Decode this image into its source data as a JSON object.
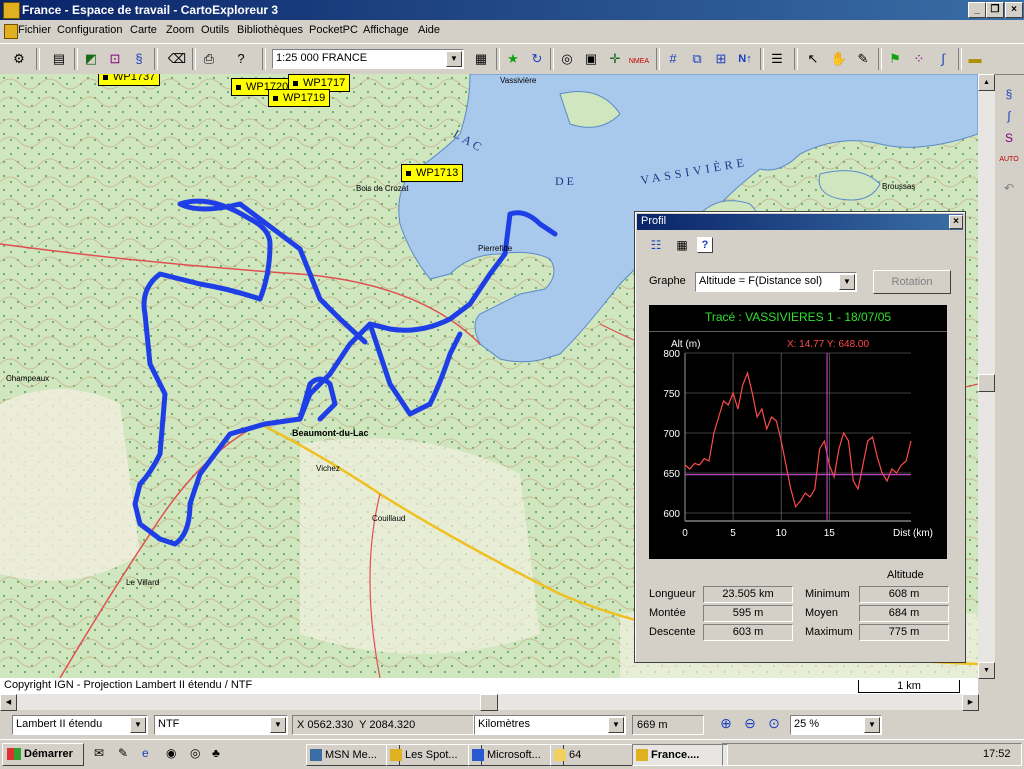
{
  "window": {
    "title": "France - Espace de travail - CartoExploreur 3"
  },
  "menu": [
    "Fichier",
    "Configuration",
    "Carte",
    "Zoom",
    "Outils",
    "Bibliothèques",
    "PocketPC",
    "Affichage",
    "Aide"
  ],
  "toolbar": {
    "scale": "1:25 000 FRANCE",
    "nmea": "NMEA",
    "north": "N↑"
  },
  "map": {
    "lake_words": [
      "LAC",
      "DE",
      "VASSIVIÈRE"
    ],
    "places": [
      "Vassivière",
      "Bois de Crozat",
      "Pierrefitte",
      "Beaumont-du-Lac",
      "Vichez",
      "Broussas",
      "Le Villard",
      "Couillaud",
      "Champeaux"
    ],
    "waypoints": [
      "WP1737",
      "WP1720",
      "WP1717",
      "WP1719",
      "WP1713"
    ]
  },
  "copyright": "Copyright IGN - Projection Lambert II étendu / NTF",
  "scalebar": "1 km",
  "status": {
    "projection": "Lambert II étendu",
    "datum": "NTF",
    "coords": "X 0562.330  Y 2084.320",
    "units": "Kilomètres",
    "altitude": "669 m",
    "zoom": "25 %"
  },
  "profil": {
    "title": "Profil",
    "graphe_label": "Graphe",
    "graphe_value": "Altitude = F(Distance sol)",
    "rotation_label": "Rotation",
    "trace_title": "Tracé : VASSIVIERES 1 - 18/07/05",
    "cursor_readout": "X: 14.77  Y: 648.00",
    "altitude_header": "Altitude",
    "stats": {
      "longueur_label": "Longueur",
      "longueur": "23.505 km",
      "montee_label": "Montée",
      "montee": "595 m",
      "descente_label": "Descente",
      "descente": "603 m",
      "minimum_label": "Minimum",
      "minimum": "608 m",
      "moyen_label": "Moyen",
      "moyen": "684 m",
      "maximum_label": "Maximum",
      "maximum": "775 m"
    }
  },
  "chart_data": {
    "type": "line",
    "title": "Tracé : VASSIVIERES 1 - 18/07/05",
    "xlabel": "Dist (km)",
    "ylabel": "Alt (m)",
    "xlim": [
      0,
      23.5
    ],
    "ylim": [
      590,
      800
    ],
    "xticks": [
      0,
      5,
      10,
      15
    ],
    "yticks": [
      600,
      650,
      700,
      750,
      800
    ],
    "cursor": {
      "x": 14.77,
      "y": 648
    },
    "x": [
      0,
      0.5,
      1,
      1.5,
      2,
      2.5,
      3,
      3.5,
      4,
      4.5,
      5,
      5.5,
      6,
      6.5,
      7,
      7.5,
      8,
      8.5,
      9,
      9.5,
      10,
      10.5,
      11,
      11.5,
      12,
      12.5,
      13,
      13.5,
      14,
      14.5,
      15,
      15.5,
      16,
      16.5,
      17,
      17.5,
      18,
      18.5,
      19,
      19.5,
      20,
      20.5,
      21,
      21.5,
      22,
      22.5,
      23,
      23.5
    ],
    "y": [
      660,
      655,
      662,
      660,
      668,
      665,
      700,
      720,
      740,
      735,
      750,
      730,
      760,
      775,
      750,
      720,
      730,
      705,
      720,
      715,
      690,
      660,
      630,
      608,
      615,
      625,
      620,
      630,
      680,
      690,
      660,
      645,
      680,
      700,
      690,
      640,
      630,
      660,
      690,
      695,
      670,
      650,
      640,
      655,
      650,
      660,
      665,
      690
    ],
    "grid": true
  },
  "taskbar": {
    "start": "Démarrer",
    "tasks": [
      "MSN Me...",
      "Les Spot...",
      "Microsoft...",
      "64",
      "France...."
    ],
    "clock": "17:52"
  },
  "colors": {
    "track": "#1f3fe6",
    "title_bar": "#0a246a",
    "lake": "#a8c8ec",
    "profile_line": "#ff4a4a"
  }
}
